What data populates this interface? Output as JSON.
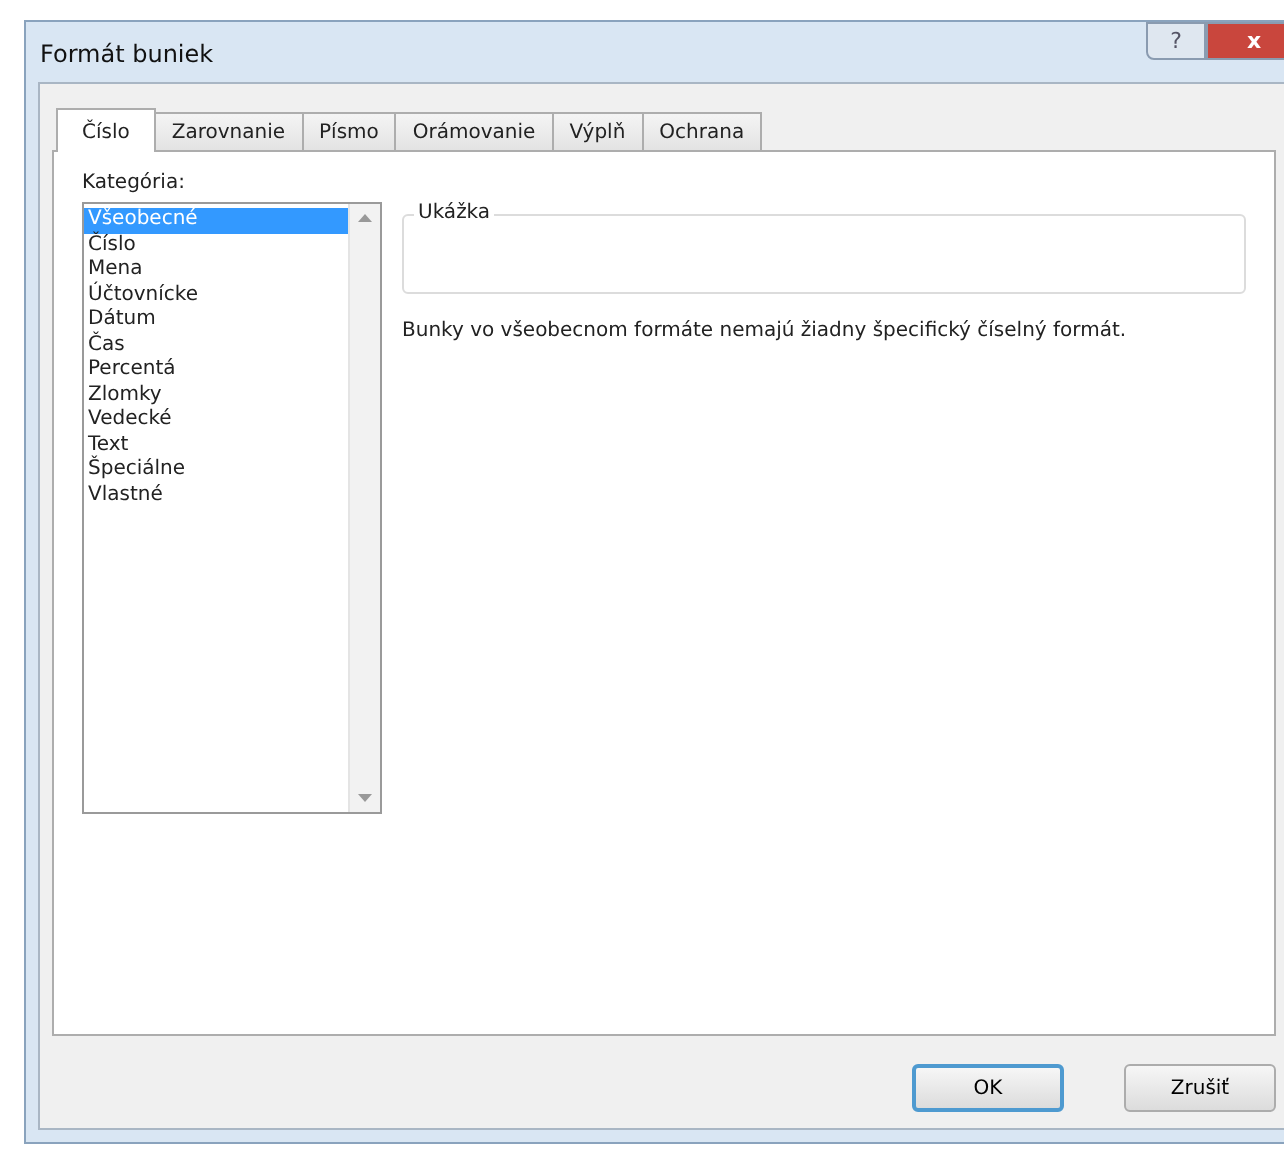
{
  "window": {
    "title": "Formát buniek",
    "help_button": "?",
    "close_button": "x"
  },
  "tabs": [
    {
      "label": "Číslo",
      "selected": true
    },
    {
      "label": "Zarovnanie",
      "selected": false
    },
    {
      "label": "Písmo",
      "selected": false
    },
    {
      "label": "Orámovanie",
      "selected": false
    },
    {
      "label": "Výplň",
      "selected": false
    },
    {
      "label": "Ochrana",
      "selected": false
    }
  ],
  "category": {
    "label": "Kategória:",
    "items": [
      {
        "label": "Všeobecné",
        "selected": true
      },
      {
        "label": "Číslo",
        "selected": false
      },
      {
        "label": "Mena",
        "selected": false
      },
      {
        "label": "Účtovnícke",
        "selected": false
      },
      {
        "label": "Dátum",
        "selected": false
      },
      {
        "label": "Čas",
        "selected": false
      },
      {
        "label": "Percentá",
        "selected": false
      },
      {
        "label": "Zlomky",
        "selected": false
      },
      {
        "label": "Vedecké",
        "selected": false
      },
      {
        "label": "Text",
        "selected": false
      },
      {
        "label": "Špeciálne",
        "selected": false
      },
      {
        "label": "Vlastné",
        "selected": false
      }
    ]
  },
  "preview": {
    "label": "Ukážka"
  },
  "description": "Bunky vo všeobecnom formáte nemajú žiadny špecifický číselný formát.",
  "buttons": [
    {
      "label": "OK",
      "default": true
    },
    {
      "label": "Zrušiť",
      "default": false
    }
  ]
}
